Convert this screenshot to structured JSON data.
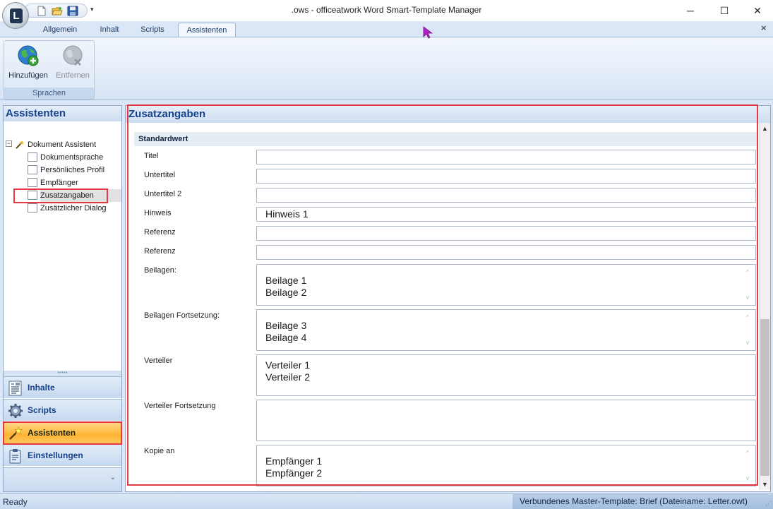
{
  "window": {
    "title": ".ows - officeatwork Word Smart-Template Manager",
    "minimize": "─",
    "maximize": "☐",
    "close": "✕"
  },
  "app_logo": "L",
  "qat_dropdown": "▾",
  "ribbon_tabs": [
    {
      "label": "Allgemein",
      "active": false
    },
    {
      "label": "Inhalt",
      "active": false
    },
    {
      "label": "Scripts",
      "active": false
    },
    {
      "label": "Assistenten",
      "active": true
    }
  ],
  "ribbon_close": "×",
  "ribbon": {
    "group_label": "Sprachen",
    "add_label": "Hinzufügen",
    "remove_label": "Entfernen"
  },
  "left_panel": {
    "title": "Assistenten",
    "tree_root": "Dokument Assistent",
    "tree_expander": "−",
    "tree_items": [
      {
        "label": "Dokumentsprache"
      },
      {
        "label": "Persönliches Profil"
      },
      {
        "label": "Empfänger"
      },
      {
        "label": "Zusatzangaben",
        "selected": true
      },
      {
        "label": "Zusätzlicher Dialog"
      }
    ],
    "splitter_grip": "•••••",
    "nav": [
      {
        "label": "Inhalte",
        "icon": "document-list-icon",
        "active": false
      },
      {
        "label": "Scripts",
        "icon": "gear-icon",
        "active": false
      },
      {
        "label": "Assistenten",
        "icon": "wand-icon",
        "active": true
      },
      {
        "label": "Einstellungen",
        "icon": "settings-clipboard-icon",
        "active": false
      }
    ],
    "nav_more": "⌄"
  },
  "main_panel": {
    "title": "Zusatzangaben",
    "section": "Standardwert",
    "fields": [
      {
        "label": "Titel",
        "value": ""
      },
      {
        "label": "Untertitel",
        "value": ""
      },
      {
        "label": "Untertitel 2",
        "value": ""
      },
      {
        "label": "Hinweis",
        "value": "Hinweis 1"
      },
      {
        "label": "Referenz",
        "value": ""
      },
      {
        "label": "Referenz",
        "value": ""
      }
    ],
    "areas": [
      {
        "label": "Beilagen:",
        "line1": "Beilage 1",
        "line2": "Beilage 2"
      },
      {
        "label": "Beilagen Fortsetzung:",
        "line1": "Beilage 3",
        "line2": "Beilage 4"
      },
      {
        "label": "Verteiler",
        "line1": "Verteiler 1",
        "line2": "Verteiler 2"
      },
      {
        "label": "Verteiler Fortsetzung",
        "line1": "",
        "line2": ""
      },
      {
        "label": "Kopie an",
        "line1": "Empfänger 1",
        "line2": "Empfänger 2"
      }
    ],
    "scroll_up": "▲",
    "scroll_down": "▼",
    "area_up": "^",
    "area_down": "v"
  },
  "status": {
    "left": "Ready",
    "right": "Verbundenes Master-Template: Brief (Dateiname: Letter.owt)",
    "grip": "⋰"
  },
  "colors": {
    "highlight": "#e53945",
    "accent_orange": "#ffb536",
    "header_blue": "#15428b"
  }
}
